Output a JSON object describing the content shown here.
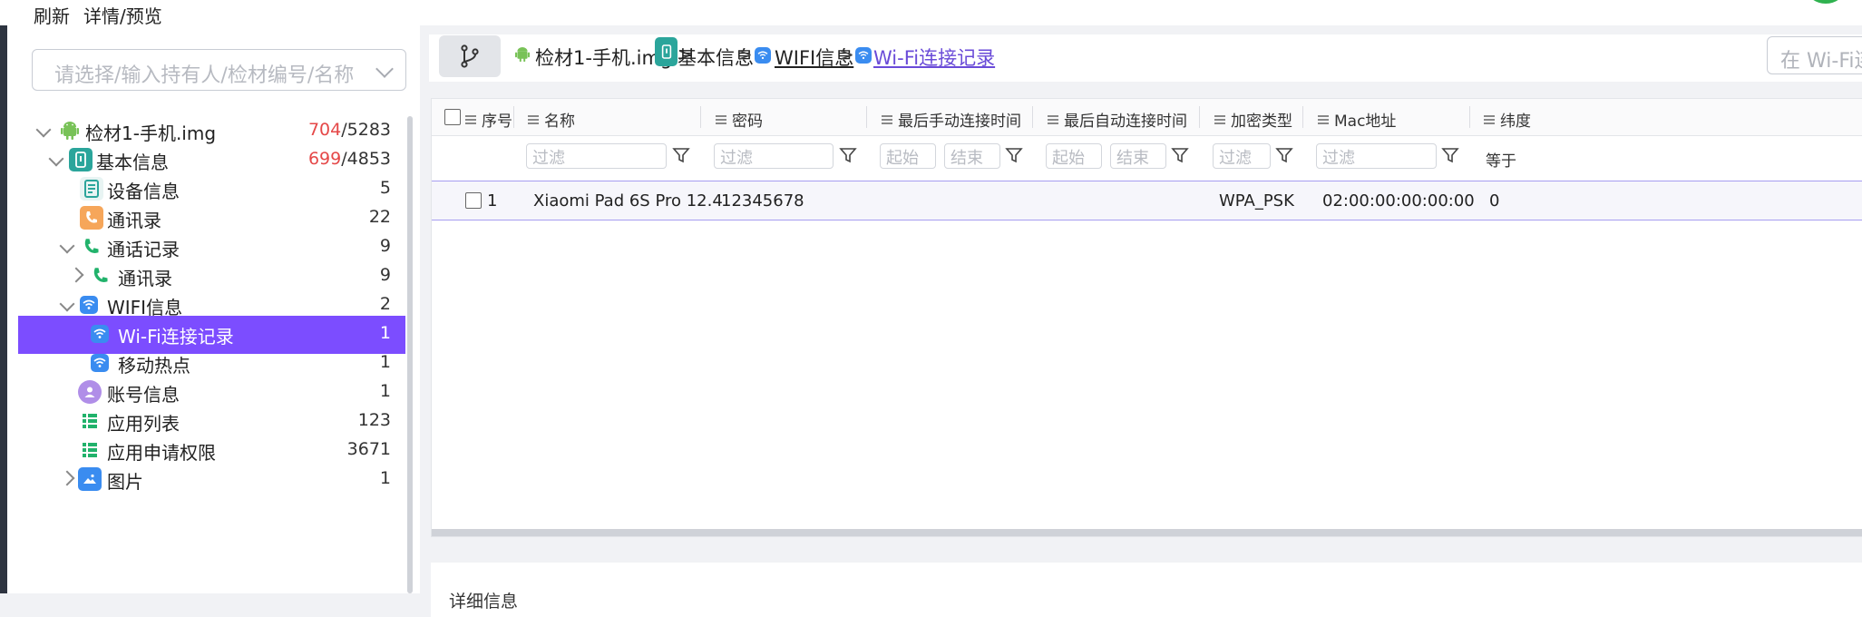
{
  "menu": {
    "refresh": "刷新",
    "detail_preview": "详情/预览"
  },
  "left": {
    "owner_placeholder": "请选择/输入持有人/检材编号/名称",
    "tree": [
      {
        "label": "检材1-手机.img",
        "count_red": "704",
        "count_rest": "/5283"
      },
      {
        "label": "基本信息",
        "count_red": "699",
        "count_rest": "/4853"
      },
      {
        "label": "设备信息",
        "count": "5"
      },
      {
        "label": "通讯录",
        "count": "22"
      },
      {
        "label": "通话记录",
        "count": "9"
      },
      {
        "label": "通讯录",
        "count": "9"
      },
      {
        "label": "WIFI信息",
        "count": "2"
      },
      {
        "label": "Wi-Fi连接记录",
        "count": "1"
      },
      {
        "label": "移动热点",
        "count": "1"
      },
      {
        "label": "账号信息",
        "count": "1"
      },
      {
        "label": "应用列表",
        "count": "123"
      },
      {
        "label": "应用申请权限",
        "count": "3671"
      },
      {
        "label": "图片",
        "count": "1"
      }
    ]
  },
  "breadcrumb": {
    "item1": "检材1-手机.img",
    "item2": "基本信息",
    "item3": "WIFI信息",
    "item4": "Wi-Fi连接记录",
    "sep": ">",
    "search_placeholder": "在 Wi-Fi连接记录中搜索"
  },
  "grid": {
    "headers": {
      "index": "序号",
      "name": "名称",
      "password": "密码",
      "last_manual": "最后手动连接时间",
      "last_auto": "最后自动连接时间",
      "encryption": "加密类型",
      "mac": "Mac地址",
      "latitude": "纬度"
    },
    "filters": {
      "filter": "过滤",
      "start": "起始",
      "end": "结束",
      "equals": "等于"
    },
    "rows": [
      {
        "index": "1",
        "name": "Xiaomi Pad 6S Pro 12.4",
        "password": "12345678",
        "last_manual": "",
        "last_auto": "",
        "encryption": "WPA_PSK",
        "mac": "02:00:00:00:00:00",
        "latitude": "0"
      }
    ]
  },
  "detail": {
    "title": "详细信息"
  },
  "colors": {
    "accent": "#7c4dff",
    "android": "#78c257",
    "teal": "#2ba59b",
    "wifi": "#3a8cf0"
  }
}
